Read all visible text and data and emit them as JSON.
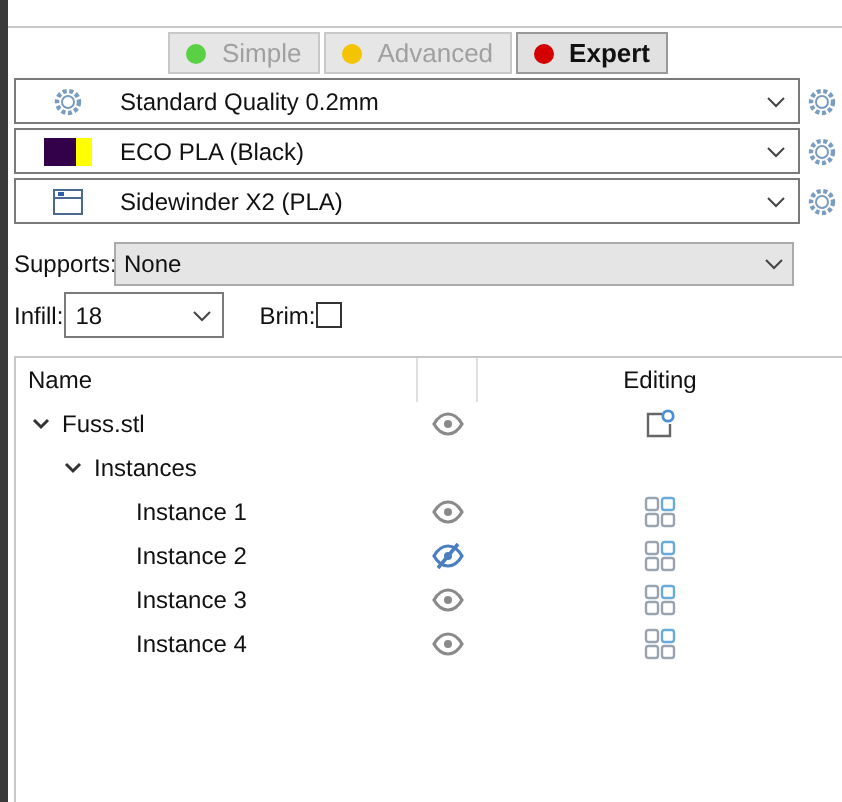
{
  "modes": [
    {
      "label": "Simple",
      "color": "#5ad144",
      "selected": false
    },
    {
      "label": "Advanced",
      "color": "#f5c400",
      "selected": false
    },
    {
      "label": "Expert",
      "color": "#d40000",
      "selected": true
    }
  ],
  "presets": [
    {
      "kind": "print",
      "value": "Standard Quality 0.2mm"
    },
    {
      "kind": "filament",
      "value": "ECO PLA (Black)",
      "swatches": [
        {
          "color": "#33004a"
        },
        {
          "color": "#ffff00"
        }
      ]
    },
    {
      "kind": "printer",
      "value": "Sidewinder X2 (PLA)"
    }
  ],
  "supports": {
    "label": "Supports:",
    "value": "None"
  },
  "infill": {
    "label": "Infill:",
    "value": "18"
  },
  "brim": {
    "label": "Brim:",
    "checked": false
  },
  "tree": {
    "columns": [
      "Name",
      "Editing"
    ],
    "items": [
      {
        "name": "Fuss.stl",
        "kind": "object",
        "visible": true,
        "expanded": true,
        "children": [
          {
            "name": "Instances",
            "kind": "group",
            "expanded": true,
            "children": [
              {
                "name": "Instance 1",
                "kind": "instance",
                "visible": true
              },
              {
                "name": "Instance 2",
                "kind": "instance",
                "visible": false
              },
              {
                "name": "Instance 3",
                "kind": "instance",
                "visible": true
              },
              {
                "name": "Instance 4",
                "kind": "instance",
                "visible": true
              }
            ]
          }
        ]
      }
    ]
  }
}
